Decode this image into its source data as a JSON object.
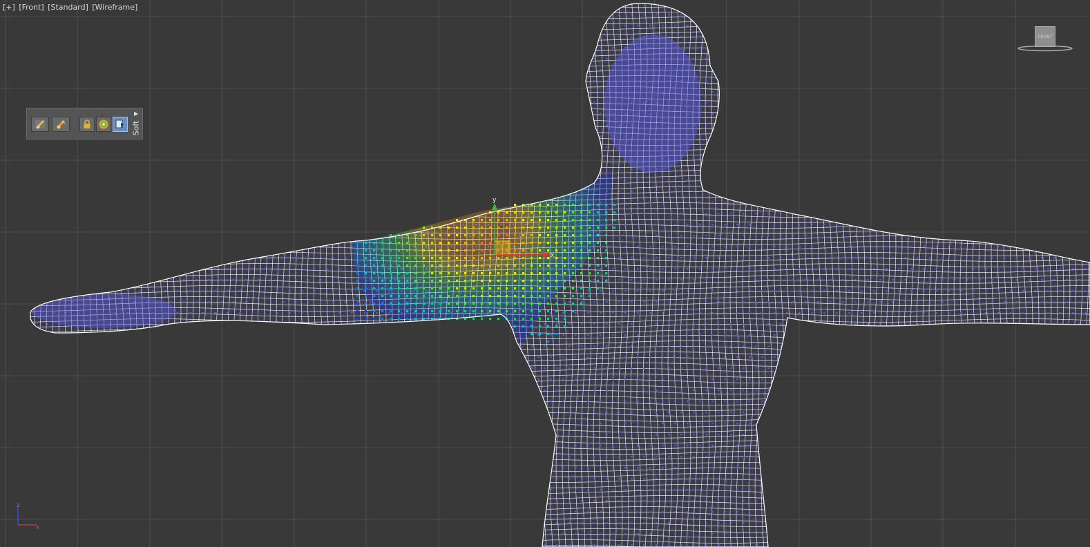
{
  "viewport": {
    "label_parts": [
      "[+]",
      "[Front]",
      "[Standard]",
      "[Wireframe]"
    ],
    "background_color": "#393939",
    "grid_color": "#4e4e4e",
    "wire_color": "#ffffff",
    "vertex_color": "#5b5bee",
    "view_mode": "Wireframe",
    "view": "Front"
  },
  "soft_selection_toolbar": {
    "label": "Soft",
    "buttons": [
      {
        "name": "paint-soft-selection",
        "icon": "brush-icon",
        "active": false
      },
      {
        "name": "blur-soft-selection",
        "icon": "blur-brush-icon",
        "active": false
      },
      {
        "name": "lock-soft-selection",
        "icon": "lock-icon",
        "active": false
      },
      {
        "name": "edge-distance",
        "icon": "target-icon",
        "active": false
      },
      {
        "name": "affect-backfacing",
        "icon": "backface-icon",
        "active": true
      }
    ]
  },
  "viewcube": {
    "face_label": "FRONT"
  },
  "gizmo": {
    "x_label": "x",
    "y_label": "y"
  },
  "tripod": {
    "x_label": "x",
    "z_label": "z"
  }
}
